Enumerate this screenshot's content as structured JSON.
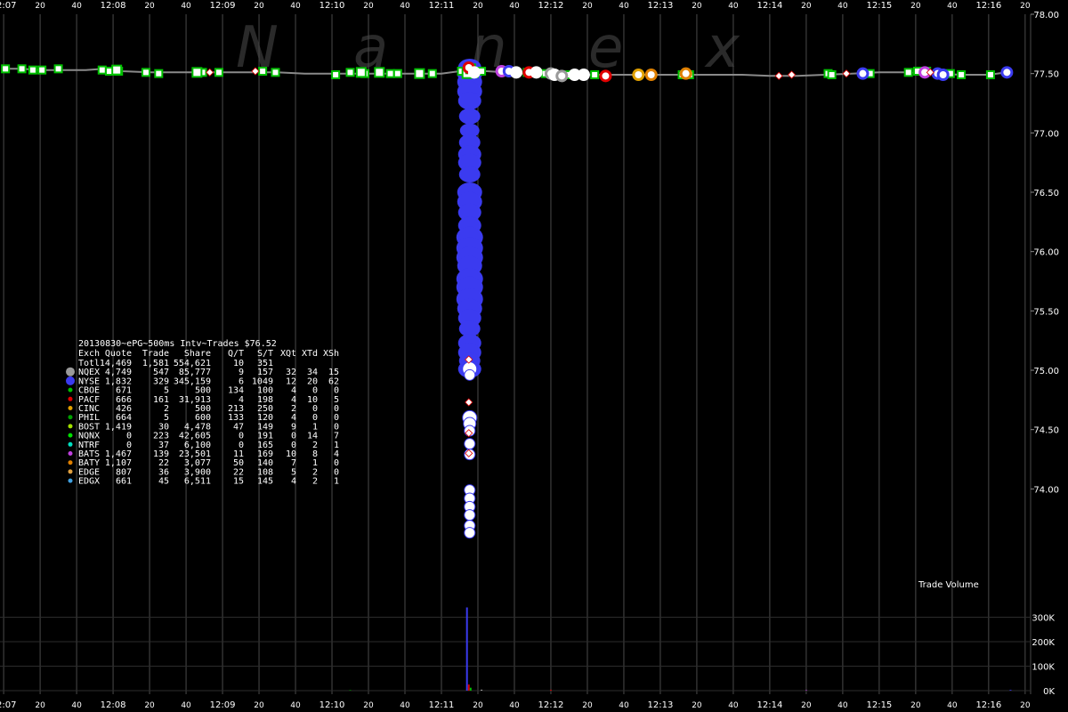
{
  "chart_data": {
    "type": "scatter",
    "watermark": [
      "N",
      "a",
      "n",
      "e",
      "x"
    ],
    "x_ticks": [
      {
        "t": 0,
        "label": "12:07"
      },
      {
        "t": 20,
        "label": "20"
      },
      {
        "t": 40,
        "label": "40"
      },
      {
        "t": 60,
        "label": "12:08"
      },
      {
        "t": 80,
        "label": "20"
      },
      {
        "t": 100,
        "label": "40"
      },
      {
        "t": 120,
        "label": "12:09"
      },
      {
        "t": 140,
        "label": "20"
      },
      {
        "t": 160,
        "label": "40"
      },
      {
        "t": 180,
        "label": "12:10"
      },
      {
        "t": 200,
        "label": "20"
      },
      {
        "t": 220,
        "label": "40"
      },
      {
        "t": 240,
        "label": "12:11"
      },
      {
        "t": 260,
        "label": "20"
      },
      {
        "t": 280,
        "label": "40"
      },
      {
        "t": 300,
        "label": "12:12"
      },
      {
        "t": 320,
        "label": "20"
      },
      {
        "t": 340,
        "label": "40"
      },
      {
        "t": 360,
        "label": "12:13"
      },
      {
        "t": 380,
        "label": "20"
      },
      {
        "t": 400,
        "label": "40"
      },
      {
        "t": 420,
        "label": "12:14"
      },
      {
        "t": 440,
        "label": "20"
      },
      {
        "t": 460,
        "label": "40"
      },
      {
        "t": 480,
        "label": "12:15"
      },
      {
        "t": 500,
        "label": "20"
      },
      {
        "t": 520,
        "label": "40"
      },
      {
        "t": 540,
        "label": "12:16"
      },
      {
        "t": 560,
        "label": "20"
      }
    ],
    "price_ticks": [
      {
        "v": 78.0,
        "label": "78.00"
      },
      {
        "v": 77.5,
        "label": "77.50"
      },
      {
        "v": 77.0,
        "label": "77.00"
      },
      {
        "v": 76.5,
        "label": "76.50"
      },
      {
        "v": 76.0,
        "label": "76.00"
      },
      {
        "v": 75.5,
        "label": "75.50"
      },
      {
        "v": 75.0,
        "label": "75.00"
      },
      {
        "v": 74.5,
        "label": "74.50"
      },
      {
        "v": 74.0,
        "label": "74.00"
      }
    ],
    "volume_ticks": [
      {
        "v": 300000,
        "label": "300K"
      },
      {
        "v": 200000,
        "label": "200K"
      },
      {
        "v": 100000,
        "label": "100K"
      },
      {
        "v": 0,
        "label": "0K"
      }
    ],
    "volume_label": "Trade Volume",
    "legend": {
      "title": "20130830~ePG~500ms Intv~Trades $76.52",
      "columns": [
        "Exch",
        "Quote",
        "Trade",
        "Share",
        "Q/T",
        "S/T",
        "XQt",
        "XTd",
        "XSh"
      ],
      "rows": [
        {
          "exch": "Totl",
          "color": "",
          "cells": [
            "14,469",
            "1,581",
            "554,621",
            "10",
            "351",
            "",
            "",
            ""
          ]
        },
        {
          "exch": "NQEX",
          "color": "#9a9a9a",
          "cells": [
            "4,749",
            "547",
            "85,777",
            "9",
            "157",
            "32",
            "34",
            "15"
          ]
        },
        {
          "exch": "NYSE",
          "color": "#3b3bf0",
          "cells": [
            "1,832",
            "329",
            "345,159",
            "6",
            "1049",
            "12",
            "20",
            "62"
          ]
        },
        {
          "exch": "CBOE",
          "color": "#00c000",
          "cells": [
            "671",
            "5",
            "500",
            "134",
            "100",
            "4",
            "0",
            "0"
          ]
        },
        {
          "exch": "PACF",
          "color": "#e00000",
          "cells": [
            "666",
            "161",
            "31,913",
            "4",
            "198",
            "4",
            "10",
            "5"
          ]
        },
        {
          "exch": "CINC",
          "color": "#e0a000",
          "cells": [
            "426",
            "2",
            "500",
            "213",
            "250",
            "2",
            "0",
            "0"
          ]
        },
        {
          "exch": "PHIL",
          "color": "#00a000",
          "cells": [
            "664",
            "5",
            "600",
            "133",
            "120",
            "4",
            "0",
            "0"
          ]
        },
        {
          "exch": "BOST",
          "color": "#a0e000",
          "cells": [
            "1,419",
            "30",
            "4,478",
            "47",
            "149",
            "9",
            "1",
            "0"
          ]
        },
        {
          "exch": "NQNX",
          "color": "#00e000",
          "cells": [
            "0",
            "223",
            "42,605",
            "0",
            "191",
            "0",
            "14",
            "7"
          ]
        },
        {
          "exch": "NTRF",
          "color": "#00e0c0",
          "cells": [
            "0",
            "37",
            "6,100",
            "0",
            "165",
            "0",
            "2",
            "1"
          ]
        },
        {
          "exch": "BATS",
          "color": "#c040e0",
          "cells": [
            "1,467",
            "139",
            "23,501",
            "11",
            "169",
            "10",
            "8",
            "4"
          ]
        },
        {
          "exch": "BATY",
          "color": "#e08000",
          "cells": [
            "1,107",
            "22",
            "3,077",
            "50",
            "140",
            "7",
            "1",
            "0"
          ]
        },
        {
          "exch": "EDGE",
          "color": "#e0a040",
          "cells": [
            "807",
            "36",
            "3,900",
            "22",
            "108",
            "5",
            "2",
            "0"
          ]
        },
        {
          "exch": "EDGX",
          "color": "#40a0e0",
          "cells": [
            "661",
            "45",
            "6,511",
            "15",
            "145",
            "4",
            "2",
            "1"
          ]
        }
      ]
    },
    "price_line": [
      [
        0,
        77.54
      ],
      [
        10,
        77.54
      ],
      [
        20,
        77.53
      ],
      [
        30,
        77.53
      ],
      [
        45,
        77.53
      ],
      [
        55,
        77.54
      ],
      [
        65,
        77.52
      ],
      [
        80,
        77.51
      ],
      [
        95,
        77.51
      ],
      [
        110,
        77.51
      ],
      [
        125,
        77.51
      ],
      [
        135,
        77.51
      ],
      [
        150,
        77.51
      ],
      [
        165,
        77.5
      ],
      [
        180,
        77.5
      ],
      [
        195,
        77.5
      ],
      [
        210,
        77.5
      ],
      [
        225,
        77.5
      ],
      [
        240,
        77.5
      ],
      [
        250,
        77.52
      ],
      [
        255,
        77.52
      ],
      [
        265,
        77.52
      ],
      [
        275,
        77.51
      ],
      [
        285,
        77.5
      ],
      [
        300,
        77.5
      ],
      [
        315,
        77.49
      ],
      [
        330,
        77.49
      ],
      [
        345,
        77.49
      ],
      [
        360,
        77.49
      ],
      [
        375,
        77.49
      ],
      [
        390,
        77.49
      ],
      [
        405,
        77.49
      ],
      [
        420,
        77.48
      ],
      [
        435,
        77.48
      ],
      [
        450,
        77.49
      ],
      [
        465,
        77.5
      ],
      [
        480,
        77.51
      ],
      [
        495,
        77.51
      ],
      [
        510,
        77.5
      ],
      [
        525,
        77.49
      ],
      [
        540,
        77.49
      ],
      [
        550,
        77.51
      ]
    ],
    "green_squares": [
      [
        1,
        77.54
      ],
      [
        10,
        77.54
      ],
      [
        16,
        77.53
      ],
      [
        21,
        77.53
      ],
      [
        30,
        77.54
      ],
      [
        54,
        77.53
      ],
      [
        58,
        77.52
      ],
      [
        63,
        77.52
      ],
      [
        78,
        77.51
      ],
      [
        85,
        77.5
      ],
      [
        109,
        77.51
      ],
      [
        118,
        77.51
      ],
      [
        142,
        77.52
      ],
      [
        149,
        77.51
      ],
      [
        182,
        77.49
      ],
      [
        190,
        77.51
      ],
      [
        198,
        77.5
      ],
      [
        212,
        77.5
      ],
      [
        216,
        77.5
      ],
      [
        235,
        77.5
      ],
      [
        251,
        77.52
      ],
      [
        255,
        77.54
      ],
      [
        258,
        77.5
      ],
      [
        262,
        77.52
      ],
      [
        273,
        77.52
      ],
      [
        287,
        77.51
      ],
      [
        297,
        77.5
      ],
      [
        301,
        77.5
      ],
      [
        310,
        77.49
      ],
      [
        324,
        77.49
      ],
      [
        372,
        77.49
      ],
      [
        376,
        77.49
      ],
      [
        452,
        77.5
      ],
      [
        454,
        77.49
      ],
      [
        475,
        77.5
      ],
      [
        496,
        77.51
      ],
      [
        501,
        77.52
      ],
      [
        506,
        77.52
      ],
      [
        519,
        77.5
      ],
      [
        525,
        77.49
      ],
      [
        541,
        77.49
      ]
    ],
    "big_white": [
      [
        62,
        77.53
      ],
      [
        106,
        77.51
      ],
      [
        196,
        77.51
      ],
      [
        206,
        77.51
      ],
      [
        228,
        77.5
      ],
      [
        254,
        77.5
      ],
      [
        256,
        77.54
      ]
    ],
    "white_diamonds": [
      [
        113,
        77.51
      ],
      [
        138,
        77.52
      ],
      [
        255,
        75.09
      ],
      [
        255,
        74.73
      ],
      [
        255,
        74.47
      ],
      [
        255,
        74.3
      ],
      [
        425,
        77.48
      ],
      [
        432,
        77.49
      ],
      [
        462,
        77.5
      ],
      [
        508,
        77.51
      ]
    ],
    "colored_circles": [
      [
        255,
        77.55,
        "#e00000"
      ],
      [
        258,
        77.51,
        "#ffffff"
      ],
      [
        273,
        77.52,
        "#c040e0"
      ],
      [
        277,
        77.52,
        "#3b3bf0"
      ],
      [
        281,
        77.51,
        "#ffffff"
      ],
      [
        288,
        77.51,
        "#e00000"
      ],
      [
        292,
        77.51,
        "#ffffff"
      ],
      [
        300,
        77.5,
        "#9a9a9a"
      ],
      [
        302,
        77.49,
        "#ffffff"
      ],
      [
        306,
        77.48,
        "#9a9a9a"
      ],
      [
        313,
        77.49,
        "#ffffff"
      ],
      [
        318,
        77.49,
        "#ffffff"
      ],
      [
        330,
        77.48,
        "#e00000"
      ],
      [
        348,
        77.49,
        "#e0a000"
      ],
      [
        355,
        77.49,
        "#e08000"
      ],
      [
        374,
        77.5,
        "#e08000"
      ],
      [
        471,
        77.5,
        "#3b3bf0"
      ],
      [
        505,
        77.51,
        "#c040e0"
      ],
      [
        512,
        77.5,
        "#3b3bf0"
      ],
      [
        515,
        77.49,
        "#3b3bf0"
      ],
      [
        550,
        77.51,
        "#3b3bf0"
      ]
    ],
    "blue_trades": [
      [
        255,
        77.55,
        8
      ],
      [
        255,
        77.5,
        9
      ],
      [
        255,
        77.43,
        9
      ],
      [
        255,
        77.35,
        9
      ],
      [
        255,
        77.27,
        8
      ],
      [
        255,
        77.14,
        7
      ],
      [
        255,
        77.02,
        6
      ],
      [
        255,
        76.92,
        7
      ],
      [
        255,
        76.82,
        8
      ],
      [
        255,
        76.75,
        8
      ],
      [
        255,
        76.65,
        7
      ],
      [
        255,
        76.5,
        9
      ],
      [
        255,
        76.42,
        9
      ],
      [
        255,
        76.33,
        8
      ],
      [
        255,
        76.22,
        8
      ],
      [
        255,
        76.12,
        10
      ],
      [
        255,
        76.03,
        10
      ],
      [
        255,
        75.95,
        10
      ],
      [
        255,
        75.88,
        9
      ],
      [
        255,
        75.77,
        10
      ],
      [
        255,
        75.7,
        10
      ],
      [
        255,
        75.6,
        10
      ],
      [
        255,
        75.52,
        9
      ],
      [
        255,
        75.44,
        8
      ],
      [
        255,
        75.35,
        7
      ],
      [
        255,
        75.23,
        8
      ],
      [
        255,
        75.15,
        8
      ],
      [
        255,
        75.08,
        7
      ],
      [
        255,
        75.01,
        8
      ]
    ],
    "white_drop": [
      [
        255,
        75.01,
        8
      ],
      [
        255,
        74.96,
        6
      ],
      [
        255,
        74.6,
        8
      ],
      [
        255,
        74.55,
        7
      ],
      [
        255,
        74.49,
        6
      ],
      [
        255,
        74.38,
        6
      ],
      [
        255,
        74.29,
        6
      ],
      [
        255,
        73.99,
        6
      ],
      [
        255,
        73.92,
        6
      ],
      [
        255,
        73.85,
        6
      ],
      [
        255,
        73.78,
        6
      ],
      [
        255,
        73.69,
        6
      ],
      [
        255,
        73.63,
        6
      ]
    ],
    "volume_bars": [
      [
        254,
        340000,
        "#3b3bf0"
      ],
      [
        255,
        25000,
        "#e00000"
      ],
      [
        256,
        12000,
        "#00c000"
      ],
      [
        262,
        4000,
        "#9a9a9a"
      ],
      [
        300,
        3000,
        "#e00000"
      ],
      [
        190,
        2000,
        "#00c000"
      ],
      [
        440,
        2000,
        "#c040e0"
      ],
      [
        552,
        3000,
        "#3b3bf0"
      ]
    ],
    "xlim": [
      -2,
      563
    ],
    "price_ylim": [
      73.2,
      78.0
    ],
    "volume_ylim": [
      0,
      400000
    ]
  }
}
